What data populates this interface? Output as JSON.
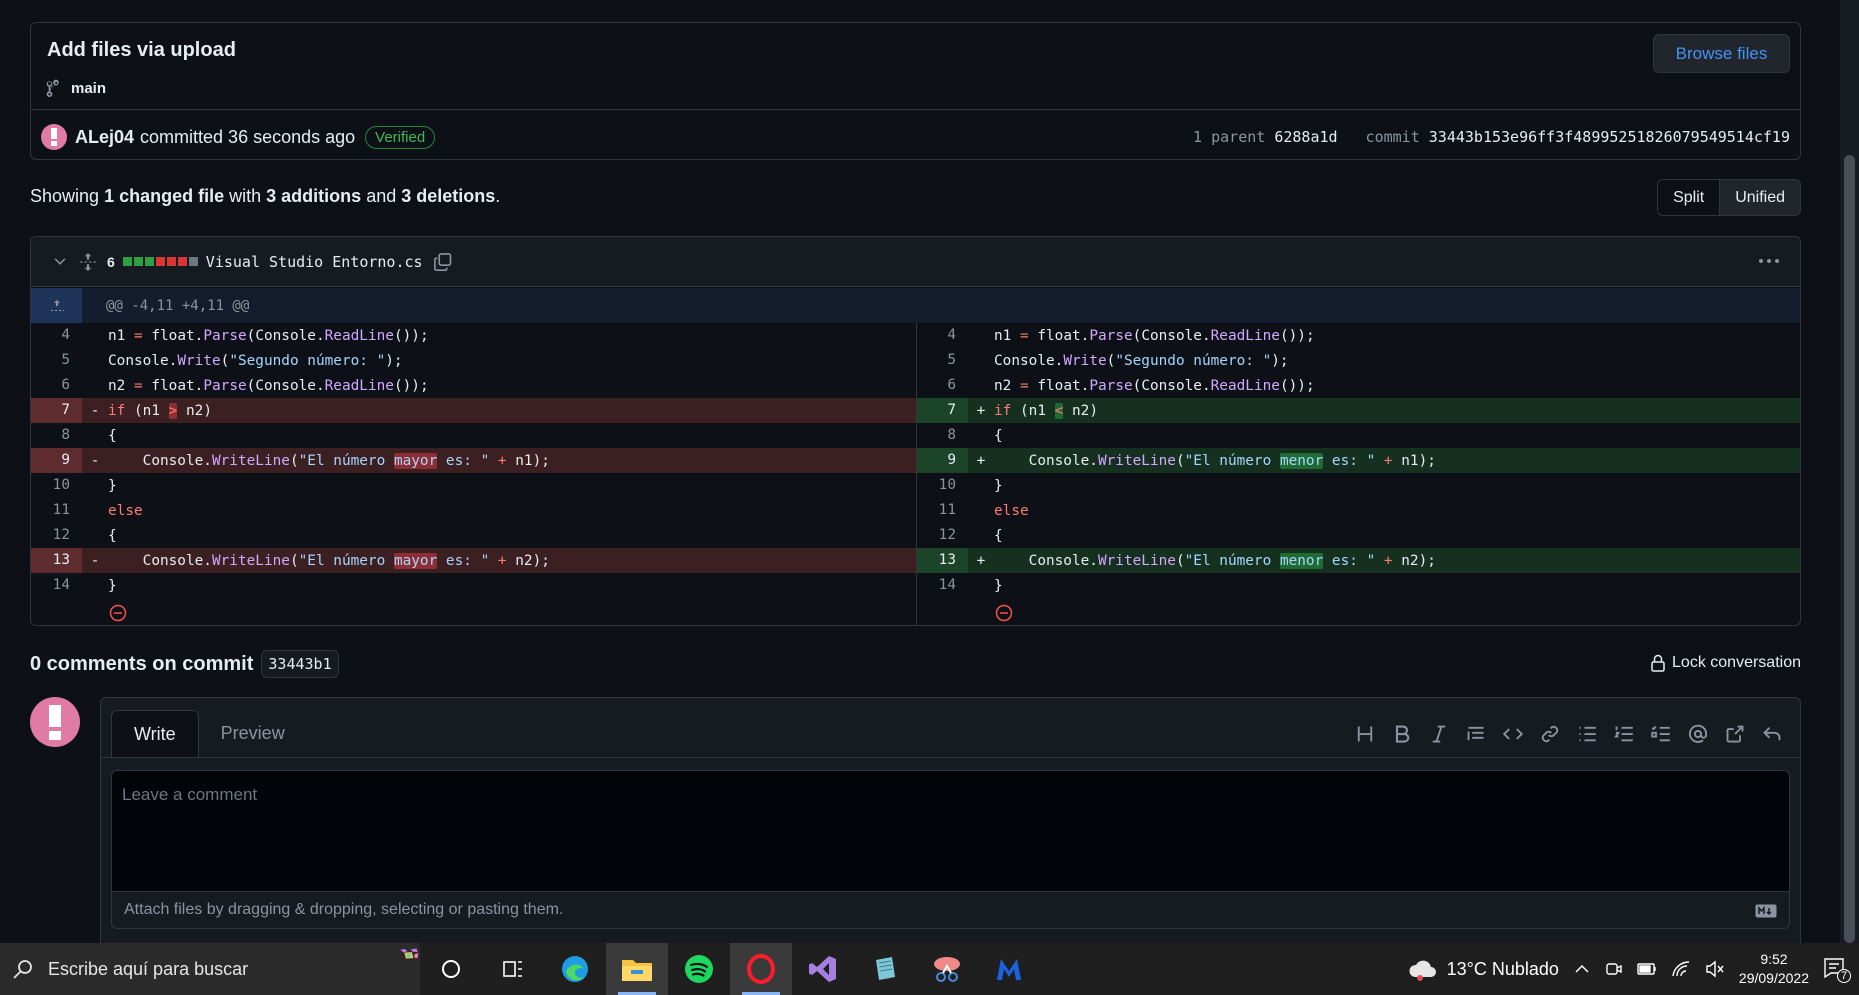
{
  "upload": {
    "title": "Add files via upload",
    "branch": "main",
    "browse_label": "Browse files"
  },
  "commit": {
    "author": "ALej04",
    "action": "committed 36 seconds ago",
    "verified": "Verified",
    "parent_label": "1 parent",
    "parent_sha": "6288a1d",
    "commit_label": "commit",
    "commit_sha": "33443b153e96ff3f4899525182607954951 4cf19"
  },
  "summary": {
    "prefix": "Showing",
    "changed": "1 changed file",
    "with": "with",
    "additions": "3 additions",
    "and": "and",
    "deletions": "3 deletions",
    "end": "."
  },
  "view": {
    "split": "Split",
    "unified": "Unified"
  },
  "file": {
    "count": "6",
    "name": "Visual Studio Entorno.cs",
    "hunk": "@@ -4,11 +4,11 @@",
    "diffstat_colors": [
      "#2ea043",
      "#2ea043",
      "#2ea043",
      "#da3633",
      "#da3633",
      "#da3633",
      "#6e7681"
    ]
  },
  "lines": {
    "n4": "4",
    "n5": "5",
    "n6": "6",
    "n7": "7",
    "n8": "8",
    "n9": "9",
    "n10": "10",
    "n11": "11",
    "n12": "12",
    "n13": "13",
    "n14": "14",
    "minus": "-",
    "plus": "+"
  },
  "comments": {
    "heading": "0 comments on commit",
    "sha": "33443b1",
    "lock": "Lock conversation",
    "tab_write": "Write",
    "tab_preview": "Preview",
    "placeholder": "Leave a comment",
    "attach": "Attach files by dragging & dropping, selecting or pasting them."
  },
  "taskbar": {
    "search_placeholder": "Escribe aquí para buscar",
    "weather": "13°C  Nublado",
    "time": "9:52",
    "date": "29/09/2022",
    "notifications": "7"
  }
}
